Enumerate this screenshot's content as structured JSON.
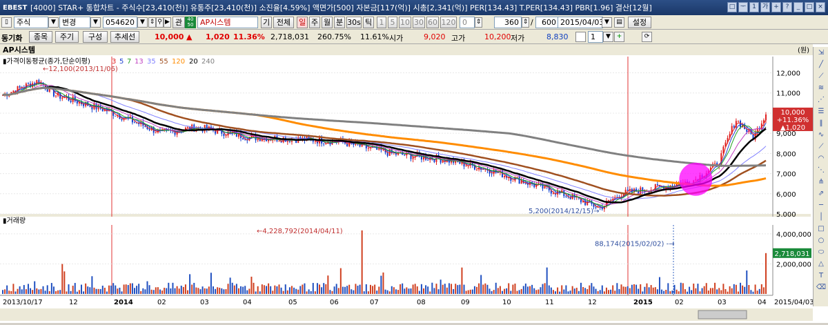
{
  "app": {
    "logo": "EBEST",
    "title": "[4000] STAR+ 통합차트 - 주식수[23,410(천)] 유통주[23,410(천)] 소진율[4.59%] 액면가[500] 자본금[117(억)] 시총[2,341(억)] PER[134.43] T.PER[134.43] PBR[1.96] 결산[12월]"
  },
  "toolbar1": {
    "market": "주식",
    "change": "변경",
    "code": "054620",
    "gwan": "관",
    "kosdaq_badge_top": "40",
    "kosdaq_badge_bottom": "50",
    "stock_name": "AP시스템",
    "gi": "기",
    "jeonche": "전체",
    "period_buttons": [
      "일",
      "주",
      "월",
      "분",
      "30s",
      "틱"
    ],
    "minute_buttons": [
      "1",
      "5",
      "10",
      "30",
      "60",
      "120"
    ],
    "zero": "0",
    "count1": "360",
    "count2": "600",
    "date": "2015/04/03",
    "settings": "설정"
  },
  "toolbar2": {
    "sync_label": "동기화",
    "item_btn": "종목",
    "period_btn": "주기",
    "compose_btn": "구성",
    "trend_btn": "추세선",
    "price": "10,000",
    "change": "1,020",
    "change_pct": "11.36%",
    "volume": "2,718,031",
    "vol_ratio": "260.75%",
    "turnover": "11.61%",
    "open_label": "시가",
    "open": "9,020",
    "high_label": "고가",
    "high": "10,200",
    "low_label": "저가",
    "low": "8,830",
    "count_select": "1"
  },
  "chart": {
    "stock_title": "AP시스템",
    "unit": "(원)",
    "price_legend_label": "가격이동평균(종가,단순이평)",
    "ma_periods": [
      "3",
      "5",
      "7",
      "13",
      "35",
      "55",
      "120",
      "20",
      "240"
    ],
    "ma_colors": [
      "#e02020",
      "#2040d0",
      "#20a020",
      "#c040c0",
      "#8080ff",
      "#a05020",
      "#ff8c00",
      "#000000",
      "#808080"
    ],
    "price_axis": [
      "12,000",
      "11,000",
      "10,000",
      "9,000",
      "8,000",
      "7,000",
      "6,000",
      "5,000"
    ],
    "high_annotation": "12,100(2013/11/06)",
    "low_annotation": "5,200(2014/12/15)",
    "last_price_box": [
      "10,000",
      "+11.36%",
      "▲1,020"
    ],
    "volume_label": "거래량",
    "volume_axis": [
      "4,000,000",
      "2,000,000"
    ],
    "vol_high_annotation": "4,228,792(2014/04/11)",
    "vol_low_annotation": "88,174(2015/02/02)",
    "last_volume_box": "2,718,031",
    "x_axis": [
      {
        "label": "2013/10/17",
        "bold": false
      },
      {
        "label": "12",
        "bold": false
      },
      {
        "label": "2014",
        "bold": true
      },
      {
        "label": "02",
        "bold": false
      },
      {
        "label": "03",
        "bold": false
      },
      {
        "label": "04",
        "bold": false
      },
      {
        "label": "05",
        "bold": false
      },
      {
        "label": "06",
        "bold": false
      },
      {
        "label": "07",
        "bold": false
      },
      {
        "label": "08",
        "bold": false
      },
      {
        "label": "09",
        "bold": false
      },
      {
        "label": "10",
        "bold": false
      },
      {
        "label": "11",
        "bold": false
      },
      {
        "label": "12",
        "bold": false
      },
      {
        "label": "2015",
        "bold": true
      },
      {
        "label": "02",
        "bold": false
      },
      {
        "label": "03",
        "bold": false
      },
      {
        "label": "04",
        "bold": false
      }
    ],
    "end_date": "2015/04/03"
  }
}
